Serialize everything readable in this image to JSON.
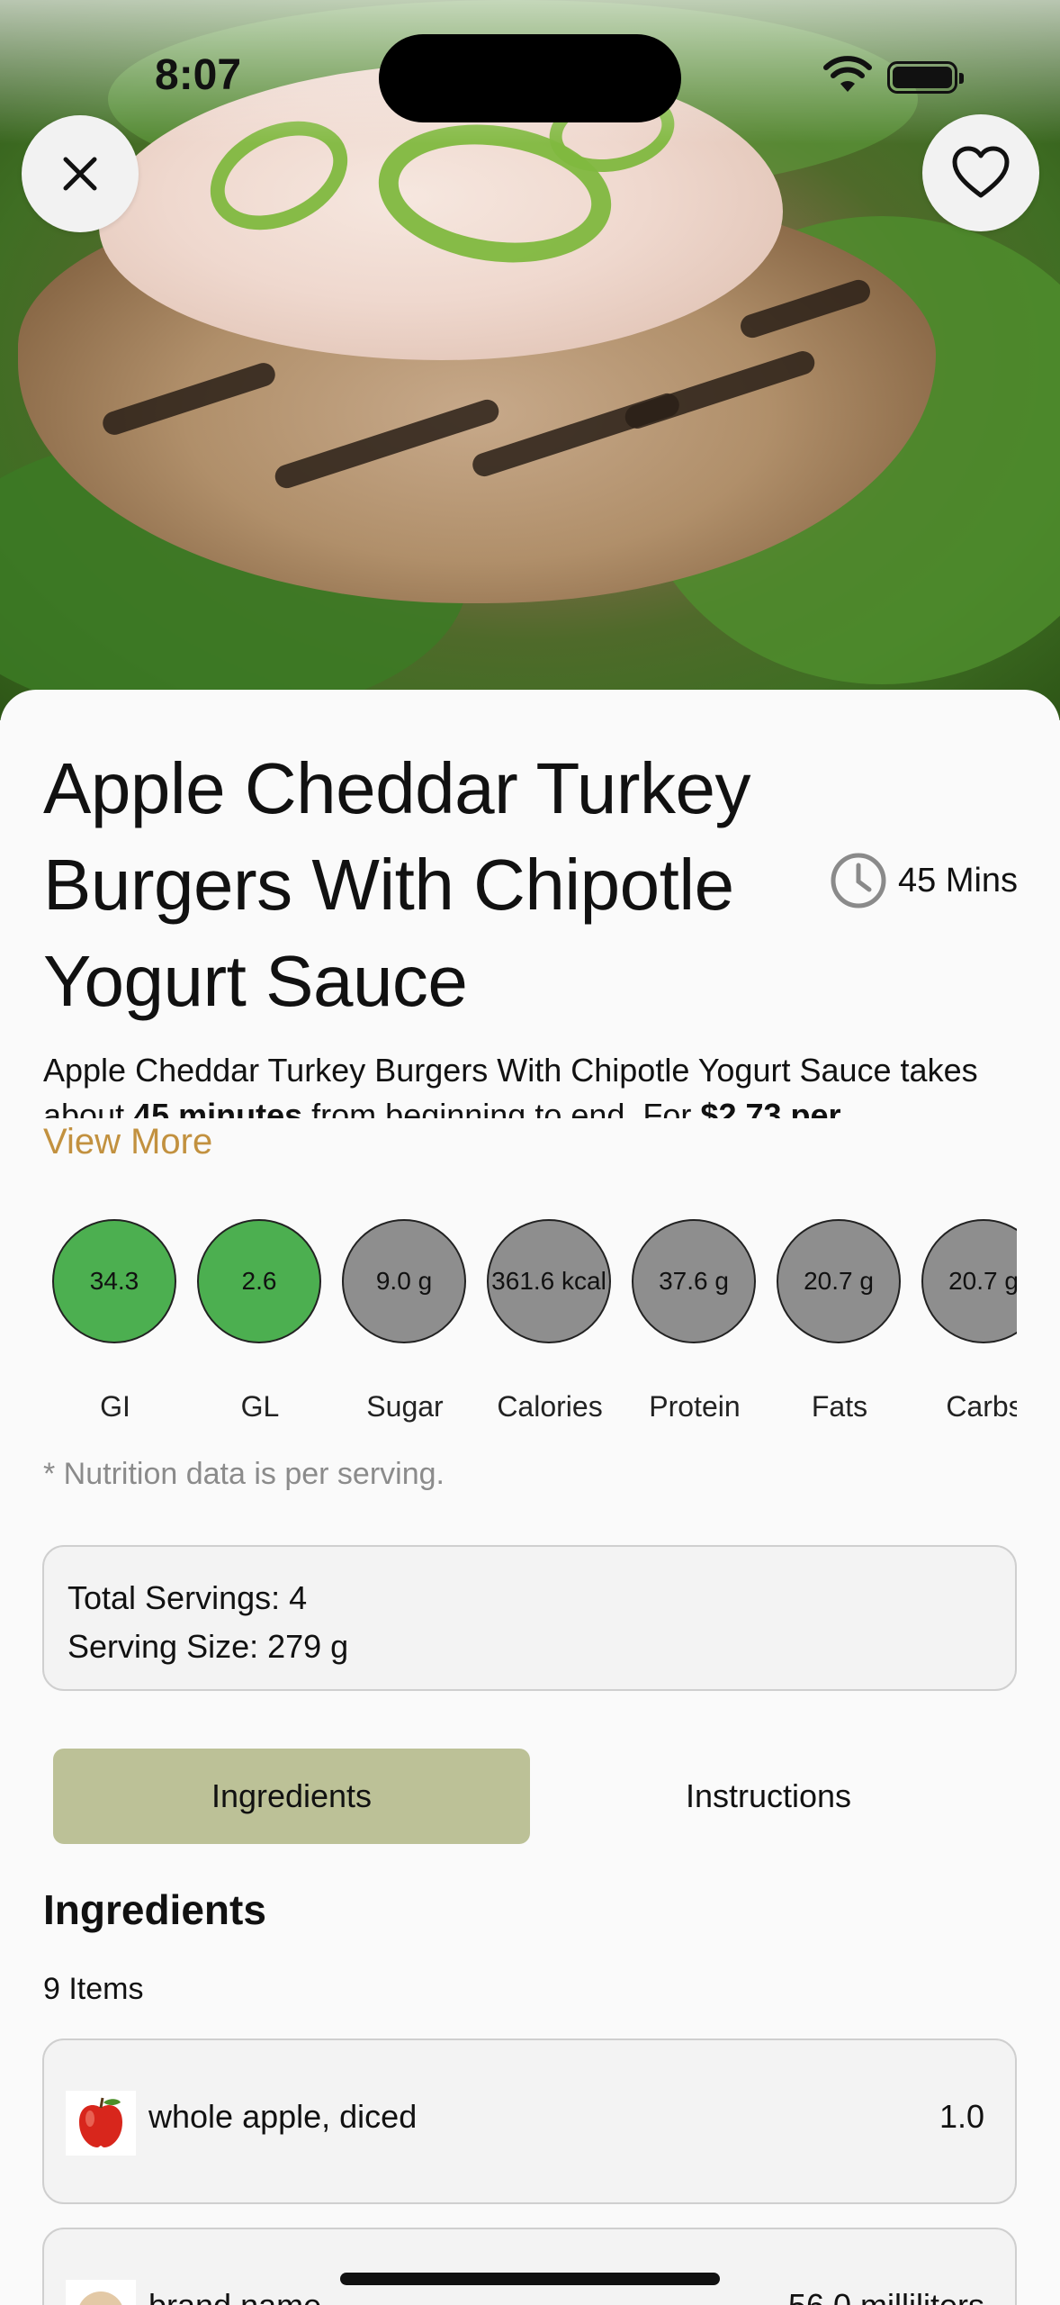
{
  "status": {
    "time": "8:07"
  },
  "header": {
    "close_icon": "close-icon",
    "favorite_icon": "heart-icon"
  },
  "recipe": {
    "title": "Apple Cheddar Turkey Burgers With Chipotle Yogurt Sauce",
    "time": "45 Mins",
    "description_parts": {
      "intro": "Apple Cheddar Turkey Burgers With Chipotle Yogurt Sauce takes about ",
      "minutes": "45 minutes",
      "middle": " from beginning to end. For ",
      "price": "$2.73 per"
    },
    "view_more": "View More"
  },
  "nutrition": {
    "items": [
      {
        "value": "34.3",
        "label": "GI",
        "color": "#4caf50"
      },
      {
        "value": "2.6",
        "label": "GL",
        "color": "#4caf50"
      },
      {
        "value": "9.0 g",
        "label": "Sugar",
        "color": "#8e8e8e"
      },
      {
        "value": "361.6 kcal",
        "label": "Calories",
        "color": "#8e8e8e"
      },
      {
        "value": "37.6 g",
        "label": "Protein",
        "color": "#8e8e8e"
      },
      {
        "value": "20.7 g",
        "label": "Fats",
        "color": "#8e8e8e"
      },
      {
        "value": "20.7 g",
        "label": "Carbs",
        "color": "#8e8e8e"
      }
    ],
    "note": "* Nutrition data is per serving."
  },
  "servings": {
    "total": "Total Servings: 4",
    "size": "Serving Size: 279 g"
  },
  "tabs": {
    "ingredients": "Ingredients",
    "instructions": "Instructions"
  },
  "ingredients": {
    "title": "Ingredients",
    "count": "9 Items",
    "items": [
      {
        "name": "whole apple, diced",
        "qty": "1.0"
      },
      {
        "name": "brand name",
        "qty": "56.0 milliliters"
      }
    ]
  }
}
